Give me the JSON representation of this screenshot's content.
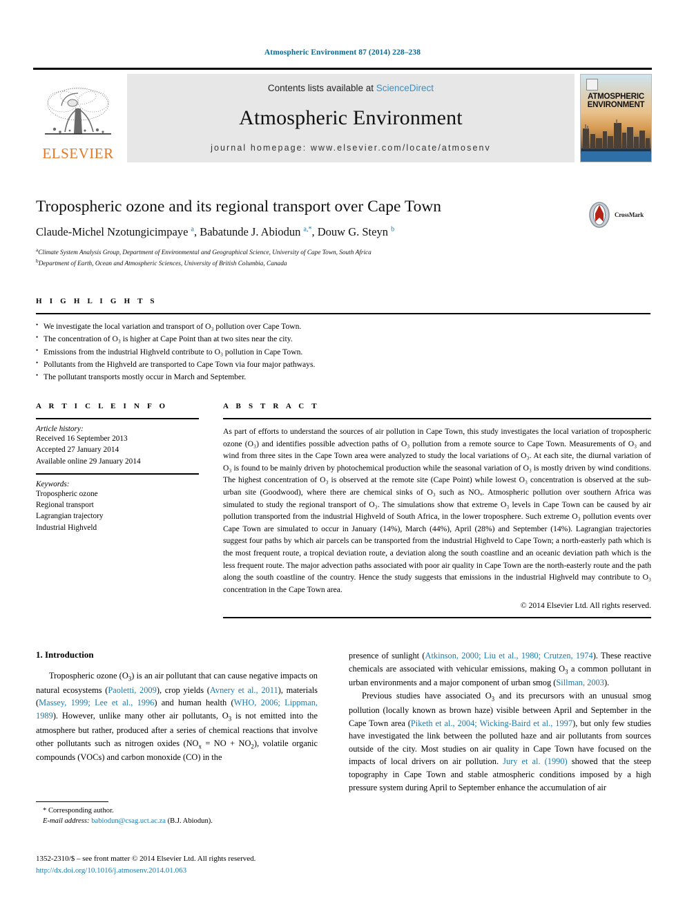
{
  "running_head": "Atmospheric Environment 87 (2014) 228–238",
  "masthead": {
    "publisher_logo_text": "ELSEVIER",
    "contents_prefix": "Contents lists available at",
    "sciencedirect": "ScienceDirect",
    "journal_title": "Atmospheric Environment",
    "homepage": "journal homepage: www.elsevier.com/locate/atmosenv",
    "cover_title_line1": "ATMOSPHERIC",
    "cover_title_line2": "ENVIRONMENT"
  },
  "crossmark": {
    "label": "CrossMark"
  },
  "article": {
    "title": "Tropospheric ozone and its regional transport over Cape Town",
    "authors_html": "Claude-Michel Nzotungicimpaye <sup>a</sup>, Babatunde J. Abiodun <sup>a,*</sup>, Douw G. Steyn <sup>b</sup>",
    "affiliation_a": "Climate System Analysis Group, Department of Environmental and Geographical Science, University of Cape Town, South Africa",
    "affiliation_b": "Department of Earth, Ocean and Atmospheric Sciences, University of British Columbia, Canada"
  },
  "highlights": {
    "heading": "H I G H L I G H T S",
    "items": [
      "We investigate the local variation and transport of O₃ pollution over Cape Town.",
      "The concentration of O₃ is higher at Cape Point than at two sites near the city.",
      "Emissions from the industrial Highveld contribute to O₃ pollution in Cape Town.",
      "Pollutants from the Highveld are transported to Cape Town via four major pathways.",
      "The pollutant transports mostly occur in March and September."
    ]
  },
  "article_info": {
    "heading": "A R T I C L E   I N F O",
    "history_label": "Article history:",
    "history": [
      "Received 16 September 2013",
      "Accepted 27 January 2014",
      "Available online 29 January 2014"
    ],
    "keywords_label": "Keywords:",
    "keywords": [
      "Tropospheric ozone",
      "Regional transport",
      "Lagrangian trajectory",
      "Industrial Highveld"
    ]
  },
  "abstract": {
    "heading": "A B S T R A C T",
    "text": "As part of efforts to understand the sources of air pollution in Cape Town, this study investigates the local variation of tropospheric ozone (O₃) and identifies possible advection paths of O₃ pollution from a remote source to Cape Town. Measurements of O₃ and wind from three sites in the Cape Town area were analyzed to study the local variations of O₃. At each site, the diurnal variation of O₃ is found to be mainly driven by photochemical production while the seasonal variation of O₃ is mostly driven by wind conditions. The highest concentration of O₃ is observed at the remote site (Cape Point) while lowest O₃ concentration is observed at the sub-urban site (Goodwood), where there are chemical sinks of O₃ such as NOₓ. Atmospheric pollution over southern Africa was simulated to study the regional transport of O₃. The simulations show that extreme O₃ levels in Cape Town can be caused by air pollution transported from the industrial Highveld of South Africa, in the lower troposphere. Such extreme O₃ pollution events over Cape Town are simulated to occur in January (14%), March (44%), April (28%) and September (14%). Lagrangian trajectories suggest four paths by which air parcels can be transported from the industrial Highveld to Cape Town; a north-easterly path which is the most frequent route, a tropical deviation route, a deviation along the south coastline and an oceanic deviation path which is the less frequent route. The major advection paths associated with poor air quality in Cape Town are the north-easterly route and the path along the south coastline of the country. Hence the study suggests that emissions in the industrial Highveld may contribute to O₃ concentration in the Cape Town area.",
    "copyright": "© 2014 Elsevier Ltd. All rights reserved."
  },
  "introduction": {
    "heading": "1. Introduction",
    "left_para_1_html": "Tropospheric ozone (O<sub>3</sub>) is an air pollutant that can cause negative impacts on natural ecosystems (<span class=\"ref\">Paoletti, 2009</span>), crop yields (<span class=\"ref\">Avnery et al., 2011</span>), materials (<span class=\"ref\">Massey, 1999; Lee et al., 1996</span>) and human health (<span class=\"ref\">WHO, 2006; Lippman, 1989</span>). However, unlike many other air pollutants, O<sub>3</sub> is not emitted into the atmosphere but rather, produced after a series of chemical reactions that involve other pollutants such as nitrogen oxides (NO<sub>x</sub> = NO + NO<sub>2</sub>), volatile organic compounds (VOCs) and carbon monoxide (CO) in the",
    "right_para_1_html": "presence of sunlight (<span class=\"ref\">Atkinson, 2000; Liu et al., 1980; Crutzen, 1974</span>). These reactive chemicals are associated with vehicular emissions, making O<sub>3</sub> a common pollutant in urban environments and a major component of urban smog (<span class=\"ref\">Sillman, 2003</span>).",
    "right_para_2_html": "Previous studies have associated O<sub>3</sub> and its precursors with an unusual smog pollution (locally known as brown haze) visible between April and September in the Cape Town area (<span class=\"ref\">Piketh et al., 2004; Wicking-Baird et al., 1997</span>), but only few studies have investigated the link between the polluted haze and air pollutants from sources outside of the city. Most studies on air quality in Cape Town have focused on the impacts of local drivers on air pollution. <span class=\"ref\">Jury et al. (1990)</span> showed that the steep topography in Cape Town and stable atmospheric conditions imposed by a high pressure system during April to September enhance the accumulation of air"
  },
  "footnote": {
    "corresponding": "* Corresponding author.",
    "email_label": "E-mail address:",
    "email": "babiodun@csag.uct.ac.za",
    "email_suffix": "(B.J. Abiodun)."
  },
  "footer": {
    "issn_line": "1352-2310/$ – see front matter © 2014 Elsevier Ltd. All rights reserved.",
    "doi": "http://dx.doi.org/10.1016/j.atmosenv.2014.01.063"
  },
  "colors": {
    "link": "#1a7aad",
    "sciencedirect": "#3a8ec4",
    "elsevier_orange": "#E87722",
    "running_head": "#0a6a94"
  }
}
